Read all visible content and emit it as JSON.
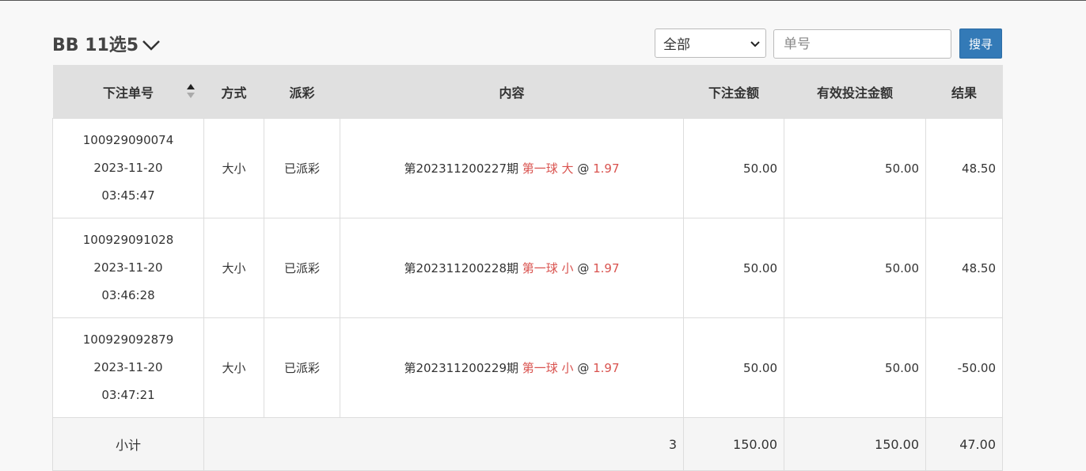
{
  "header": {
    "title": "BB 11选5",
    "filter_select": "全部",
    "order_placeholder": "单号",
    "search_label": "搜寻"
  },
  "columns": [
    "下注单号",
    "方式",
    "派彩",
    "内容",
    "下注金额",
    "有效投注金额",
    "结果"
  ],
  "rows": [
    {
      "order_no": "100929090074",
      "date": "2023-11-20",
      "time": "03:45:47",
      "method": "大小",
      "payout": "已派彩",
      "period": "第202311200227期",
      "selection": "第一球 大",
      "at": "@",
      "odds": "1.97",
      "bet": "50.00",
      "valid_bet": "50.00",
      "result": "48.50"
    },
    {
      "order_no": "100929091028",
      "date": "2023-11-20",
      "time": "03:46:28",
      "method": "大小",
      "payout": "已派彩",
      "period": "第202311200228期",
      "selection": "第一球 小",
      "at": "@",
      "odds": "1.97",
      "bet": "50.00",
      "valid_bet": "50.00",
      "result": "48.50"
    },
    {
      "order_no": "100929092879",
      "date": "2023-11-20",
      "time": "03:47:21",
      "method": "大小",
      "payout": "已派彩",
      "period": "第202311200229期",
      "selection": "第一球 小",
      "at": "@",
      "odds": "1.97",
      "bet": "50.00",
      "valid_bet": "50.00",
      "result": "-50.00"
    }
  ],
  "subtotal": {
    "label": "小计",
    "count": "3",
    "bet": "150.00",
    "valid_bet": "150.00",
    "result": "47.00"
  },
  "colors": {
    "accent": "#337ab7",
    "highlight": "#d9534f",
    "header_bg": "#e0e0e0"
  }
}
